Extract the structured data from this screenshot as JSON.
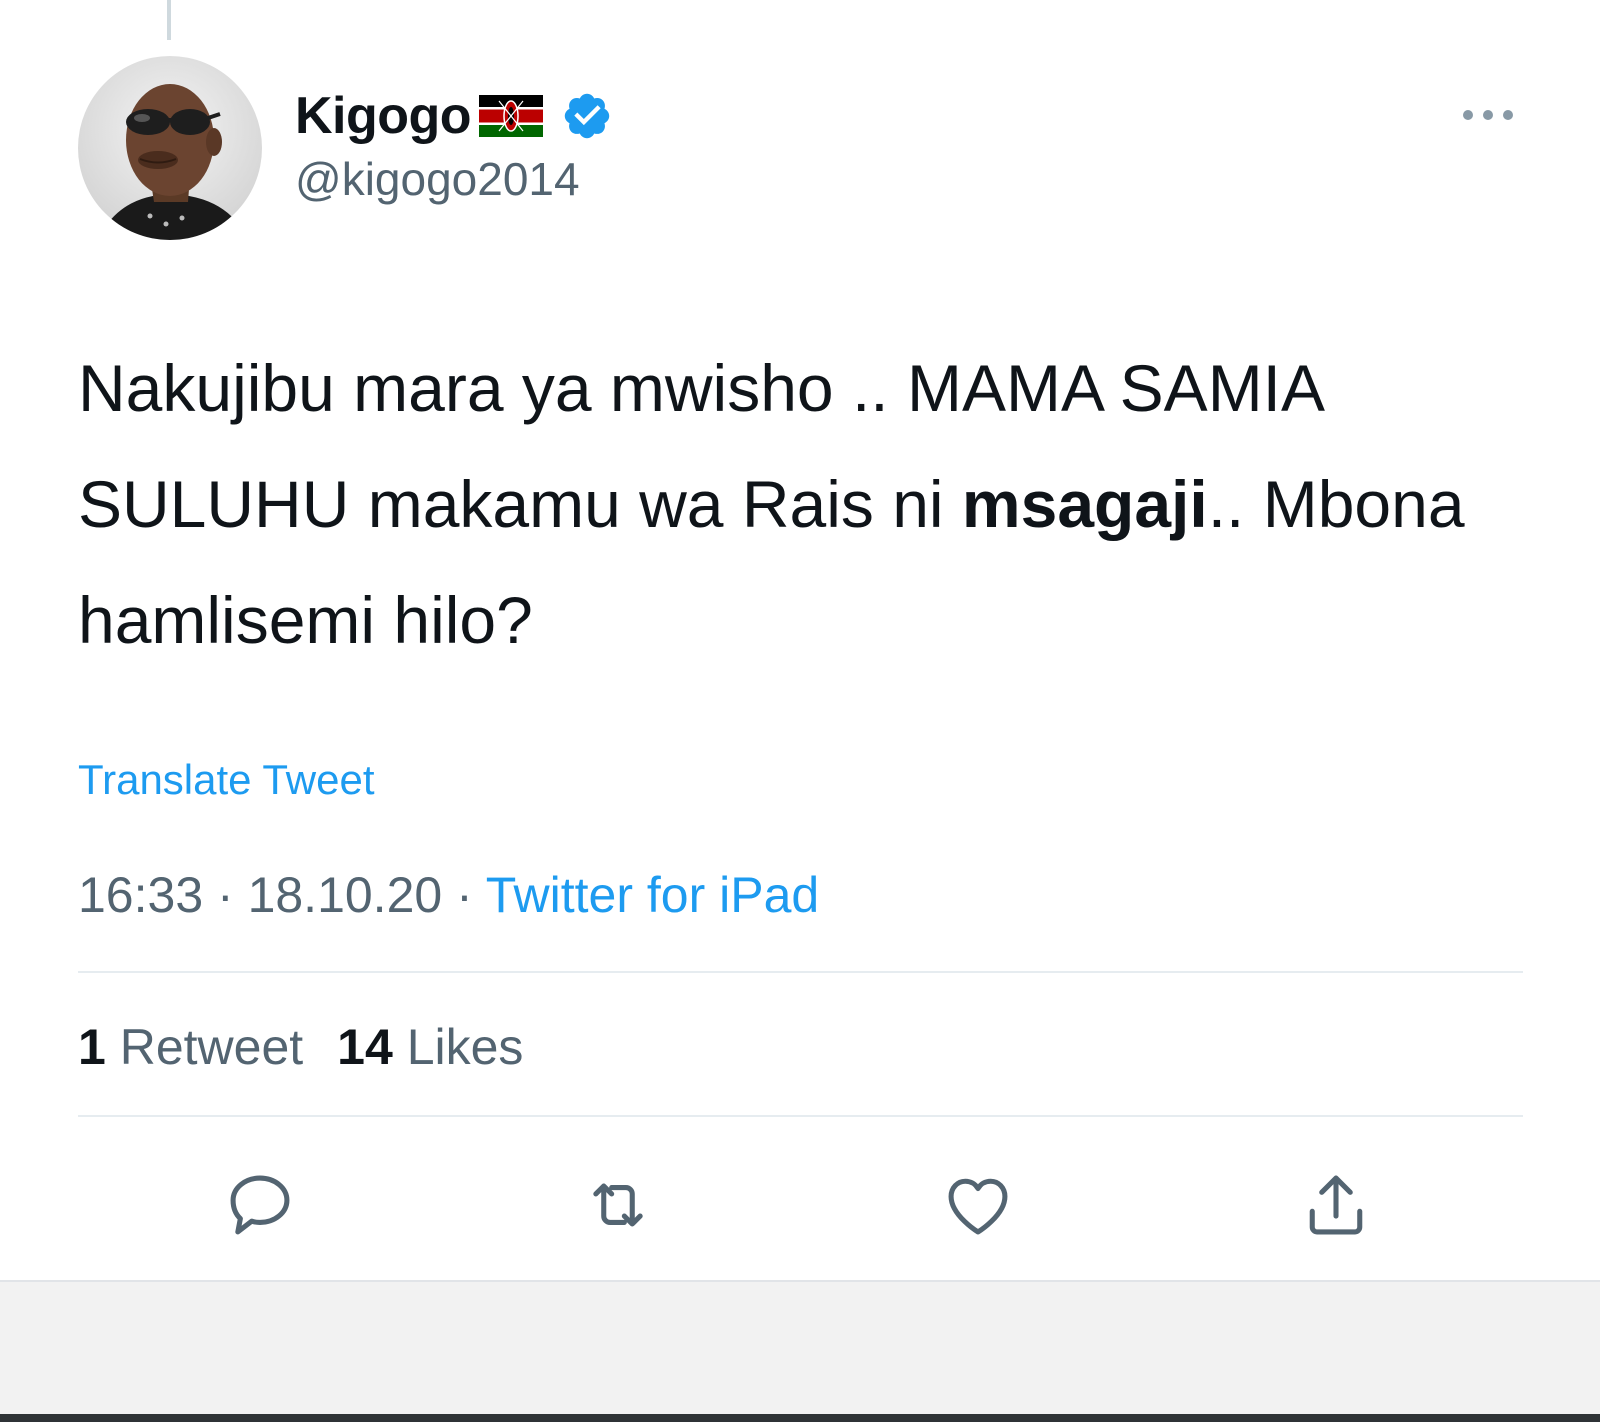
{
  "author": {
    "display_name": "Kigogo",
    "handle": "@kigogo2014",
    "flag_icon": "kenya-flag-icon",
    "verified_icon": "verified-badge-icon"
  },
  "tweet": {
    "text_part1": "Nakujibu mara ya mwisho .. MAMA SAMIA SULUHU makamu wa Rais ni ",
    "text_bold": "msagaji",
    "text_part2": ".. Mbona hamlisemi hilo?"
  },
  "translate_label": "Translate Tweet",
  "meta": {
    "time": "16:33",
    "separator": " · ",
    "date": "18.10.20",
    "source": "Twitter for iPad"
  },
  "stats": {
    "retweets_count": "1",
    "retweets_label": "Retweet",
    "likes_count": "14",
    "likes_label": "Likes"
  },
  "actions": [
    "reply-icon",
    "retweet-icon",
    "like-icon",
    "share-icon"
  ],
  "colors": {
    "accent": "#1d9bf0",
    "text": "#0f1419",
    "secondary": "#536471",
    "divider": "#e6ecf0"
  }
}
